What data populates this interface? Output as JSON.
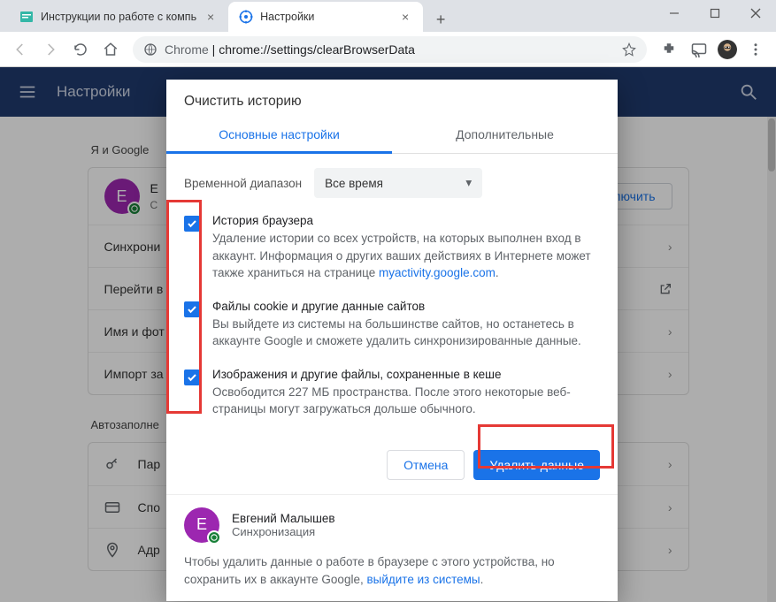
{
  "window": {
    "tabs": [
      {
        "title": "Инструкции по работе с компь"
      },
      {
        "title": "Настройки"
      }
    ]
  },
  "toolbar": {
    "url_prefix": "Chrome",
    "url_sep": " | ",
    "url": "chrome://settings/clearBrowserData"
  },
  "settings_header": {
    "title": "Настройки"
  },
  "page": {
    "section1": "Я и Google",
    "user_initial": "Е",
    "enable_button": "Включить",
    "rows1": [
      "Синхрони",
      "Перейти в",
      "Имя и фот",
      "Импорт за"
    ],
    "section2": "Автозаполне",
    "rows2": [
      "Пар",
      "Спо",
      "Адр"
    ]
  },
  "dialog": {
    "title": "Очистить историю",
    "tab_basic": "Основные настройки",
    "tab_advanced": "Дополнительные",
    "range_label": "Временной диапазон",
    "range_value": "Все время",
    "items": [
      {
        "title": "История браузера",
        "desc_pre": "Удаление истории со всех устройств, на которых выполнен вход в аккаунт. Информация о других ваших действиях в Интернете может также храниться на странице ",
        "link": "myactivity.google.com",
        "desc_post": "."
      },
      {
        "title": "Файлы cookie и другие данные сайтов",
        "desc_pre": "Вы выйдете из системы на большинстве сайтов, но останетесь в аккаунте Google и сможете удалить синхронизированные данные.",
        "link": "",
        "desc_post": ""
      },
      {
        "title": "Изображения и другие файлы, сохраненные в кеше",
        "desc_pre": "Освободится 227 МБ пространства. После этого некоторые веб-страницы могут загружаться дольше обычного.",
        "link": "",
        "desc_post": ""
      }
    ],
    "cancel": "Отмена",
    "confirm": "Удалить данные",
    "user_name": "Евгений Малышев",
    "user_sub": "Синхронизация",
    "user_initial": "Е",
    "note_pre": "Чтобы удалить данные о работе в браузере с этого устройства, но сохранить их в аккаунте Google, ",
    "note_link": "выйдите из системы",
    "note_post": "."
  }
}
